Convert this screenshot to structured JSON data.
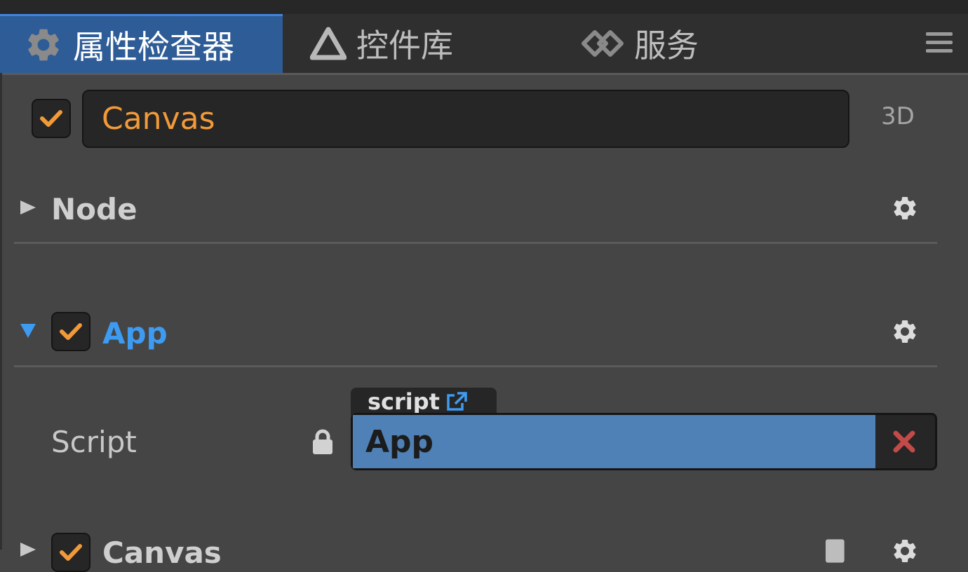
{
  "tabs": [
    {
      "label": "属性检查器",
      "icon": "gear-icon",
      "active": true
    },
    {
      "label": "控件库",
      "icon": "triangle-icon",
      "active": false
    },
    {
      "label": "服务",
      "icon": "service-icon",
      "active": false
    }
  ],
  "node": {
    "enabled": true,
    "name": "Canvas",
    "mode": "3D"
  },
  "components": [
    {
      "title": "Node",
      "expanded": false
    },
    {
      "title": "App",
      "expanded": true,
      "enabled": true
    },
    {
      "title": "Canvas",
      "expanded": false,
      "enabled": true
    }
  ],
  "script_prop": {
    "label": "Script",
    "asset_type": "script",
    "value": "App"
  },
  "colors": {
    "panel_bg": "#454545",
    "active_tab": "#2e5c97",
    "accent_orange": "#f29a3a",
    "accent_blue": "#3e9bf2",
    "asset_value_bg": "#4f81b6",
    "clear_red": "#c24a48"
  }
}
